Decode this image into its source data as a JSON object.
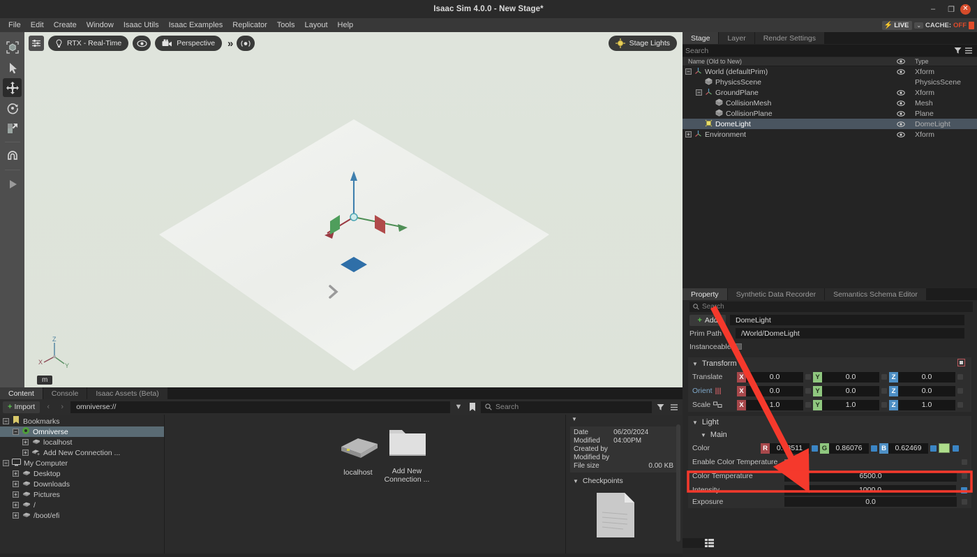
{
  "window": {
    "title": "Isaac Sim 4.0.0 - New Stage*",
    "minimize": "–",
    "maximize": "❐",
    "close": "✕"
  },
  "menubar": {
    "items": [
      "File",
      "Edit",
      "Create",
      "Window",
      "Isaac Utils",
      "Isaac Examples",
      "Replicator",
      "Tools",
      "Layout",
      "Help"
    ],
    "live_label": "LIVE",
    "live_caret": "⌄",
    "cache_label": "CACHE:",
    "cache_value": "OFF"
  },
  "left_toolbar": {
    "tools": [
      {
        "name": "select-bounds-tool",
        "active": false
      },
      {
        "name": "select-arrow-tool",
        "active": false
      },
      {
        "name": "move-tool",
        "active": true
      },
      {
        "name": "rotate-tool",
        "active": false
      },
      {
        "name": "scale-tool",
        "active": false
      },
      {
        "name": "snap-magnet-tool",
        "active": false
      },
      {
        "name": "play-tool",
        "active": false
      }
    ]
  },
  "viewport": {
    "render_mode": "RTX - Real-Time",
    "camera": "Perspective",
    "stage_lights": "Stage Lights",
    "unit": "m",
    "axes": {
      "x": "X",
      "y": "Y",
      "z": "Z"
    }
  },
  "stage": {
    "tabs": [
      {
        "label": "Stage",
        "active": true
      },
      {
        "label": "Layer",
        "active": false
      },
      {
        "label": "Render Settings",
        "active": false
      }
    ],
    "search_placeholder": "Search",
    "columns": {
      "name": "Name (Old to New)",
      "type": "Type"
    },
    "rows": [
      {
        "label": "World (defaultPrim)",
        "type": "Xform",
        "indent": 0,
        "toggle": "minus",
        "icon": "xform-axis-icon",
        "eye": true,
        "selected": false
      },
      {
        "label": "PhysicsScene",
        "type": "PhysicsScene",
        "indent": 1,
        "toggle": "none",
        "icon": "cube-icon",
        "eye": false,
        "selected": false
      },
      {
        "label": "GroundPlane",
        "type": "Xform",
        "indent": 1,
        "toggle": "minus",
        "icon": "xform-axis-icon",
        "eye": true,
        "selected": false
      },
      {
        "label": "CollisionMesh",
        "type": "Mesh",
        "indent": 2,
        "toggle": "none",
        "icon": "cube-icon",
        "eye": true,
        "selected": false
      },
      {
        "label": "CollisionPlane",
        "type": "Plane",
        "indent": 2,
        "toggle": "none",
        "icon": "cube-icon",
        "eye": true,
        "selected": false
      },
      {
        "label": "DomeLight",
        "type": "DomeLight",
        "indent": 1,
        "toggle": "none",
        "icon": "light-icon",
        "eye": true,
        "selected": true
      },
      {
        "label": "Environment",
        "type": "Xform",
        "indent": 0,
        "toggle": "plus",
        "icon": "xform-axis-icon",
        "eye": true,
        "selected": false
      }
    ]
  },
  "property": {
    "tabs": [
      {
        "label": "Property",
        "active": true
      },
      {
        "label": "Synthetic Data Recorder",
        "active": false
      },
      {
        "label": "Semantics Schema Editor",
        "active": false
      }
    ],
    "search_placeholder": "Search",
    "add_label": "Add",
    "prim_name": "DomeLight",
    "prim_path_label": "Prim Path",
    "prim_path_value": "/World/DomeLight",
    "instanceable_label": "Instanceable",
    "transform": {
      "title": "Transform",
      "rows": [
        {
          "label": "Translate",
          "x": "0.0",
          "y": "0.0",
          "z": "0.0"
        },
        {
          "label": "Orient",
          "x": "0.0",
          "y": "0.0",
          "z": "0.0"
        },
        {
          "label": "Scale",
          "x": "1.0",
          "y": "1.0",
          "z": "1.0"
        }
      ],
      "axis_labels": {
        "x": "X",
        "y": "Y",
        "z": "Z"
      }
    },
    "light": {
      "title": "Light",
      "subtitle": "Main",
      "color_label": "Color",
      "color_r_label": "R",
      "color_g_label": "G",
      "color_b_label": "B",
      "color_r": "0.68511",
      "color_g": "0.86076",
      "color_b": "0.62469",
      "color_swatch_hex": "#aede8c",
      "enable_color_temperature_label": "Enable Color Temperature",
      "color_temperature_label": "Color Temperature",
      "color_temperature_value": "6500.0",
      "intensity_label": "Intensity",
      "intensity_value": "1000.0",
      "exposure_label": "Exposure",
      "exposure_value": "0.0"
    }
  },
  "content": {
    "tabs": [
      {
        "label": "Content",
        "active": true
      },
      {
        "label": "Console",
        "active": false
      },
      {
        "label": "Isaac Assets (Beta)",
        "active": false
      }
    ],
    "import_label": "Import",
    "path": "omniverse://",
    "search_placeholder": "Search",
    "tree": [
      {
        "label": "Bookmarks",
        "indent": 0,
        "toggle": "minus",
        "icon": "bookmark-icon",
        "selected": false
      },
      {
        "label": "Omniverse",
        "indent": 1,
        "toggle": "minus",
        "icon": "omniverse-icon",
        "selected": true
      },
      {
        "label": "localhost",
        "indent": 2,
        "toggle": "plus",
        "icon": "server-icon",
        "selected": false
      },
      {
        "label": "Add New Connection ...",
        "indent": 2,
        "toggle": "plus",
        "icon": "add-connection-icon",
        "selected": false
      },
      {
        "label": "My Computer",
        "indent": 0,
        "toggle": "minus",
        "icon": "computer-icon",
        "selected": false
      },
      {
        "label": "Desktop",
        "indent": 1,
        "toggle": "plus",
        "icon": "server-icon",
        "selected": false
      },
      {
        "label": "Downloads",
        "indent": 1,
        "toggle": "plus",
        "icon": "server-icon",
        "selected": false
      },
      {
        "label": "Pictures",
        "indent": 1,
        "toggle": "plus",
        "icon": "server-icon",
        "selected": false
      },
      {
        "label": "/",
        "indent": 1,
        "toggle": "plus",
        "icon": "server-icon",
        "selected": false
      },
      {
        "label": "/boot/efi",
        "indent": 1,
        "toggle": "plus",
        "icon": "server-icon",
        "selected": false
      }
    ],
    "grid_items": [
      {
        "label": "localhost",
        "icon": "server-icon"
      },
      {
        "label": "Add New Connection ...",
        "icon": "folder-icon"
      }
    ],
    "details": {
      "date_modified_label": "Date Modified",
      "date_modified_value": "06/20/2024 04:00PM",
      "created_by_label": "Created by",
      "created_by_value": "",
      "modified_by_label": "Modified by",
      "modified_by_value": "",
      "file_size_label": "File size",
      "file_size_value": "0.00 KB",
      "checkpoints_label": "Checkpoints"
    }
  },
  "annotation": {
    "arrow_color": "#f5392c",
    "highlight_color": "#f5392c"
  }
}
